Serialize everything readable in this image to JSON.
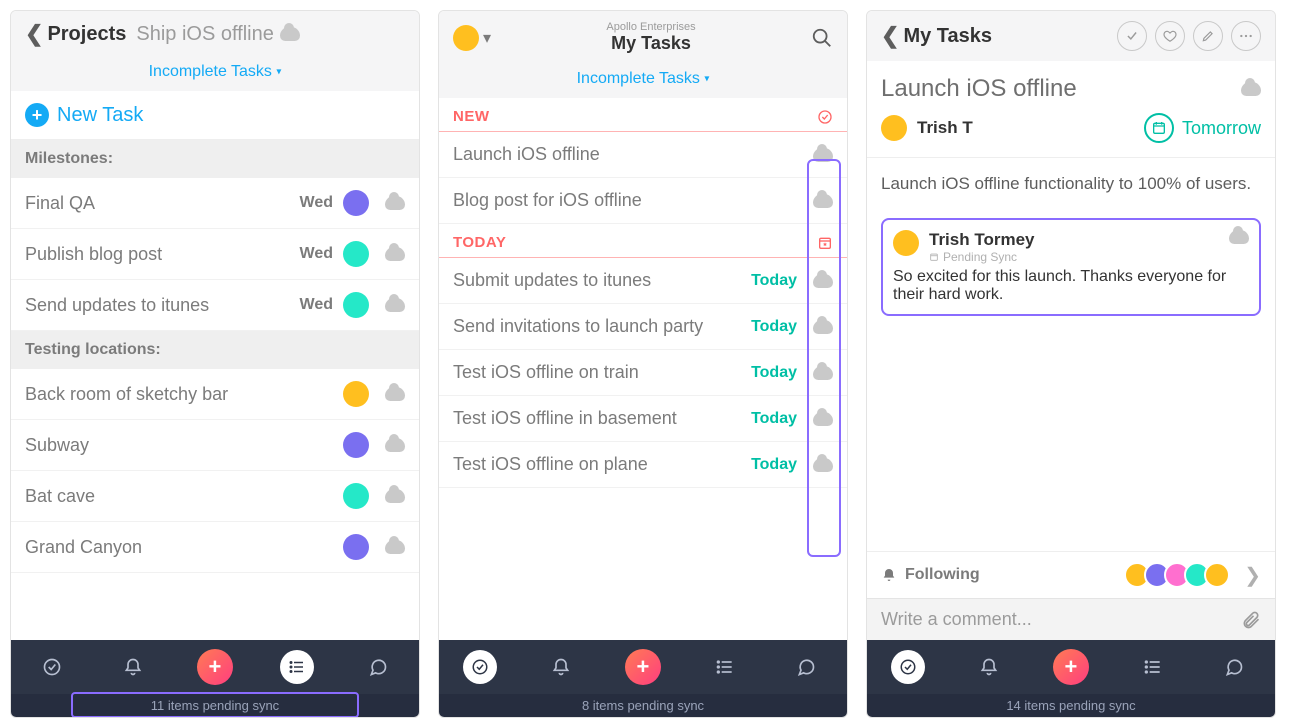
{
  "screen1": {
    "back_label": "Projects",
    "project_title": "Ship iOS offline",
    "filter": "Incomplete Tasks",
    "new_task": "New Task",
    "section_milestones": "Milestones:",
    "milestones": [
      {
        "name": "Final QA",
        "due": "Wed",
        "avatar": "purple"
      },
      {
        "name": "Publish blog post",
        "due": "Wed",
        "avatar": "green"
      },
      {
        "name": "Send updates to itunes",
        "due": "Wed",
        "avatar": "green"
      }
    ],
    "section_testing": "Testing locations:",
    "testing": [
      {
        "name": "Back room of sketchy bar",
        "avatar": "yellow"
      },
      {
        "name": "Subway",
        "avatar": "purple"
      },
      {
        "name": "Bat cave",
        "avatar": "green"
      },
      {
        "name": "Grand Canyon",
        "avatar": "purple"
      }
    ],
    "pending_sync": "11 items pending sync"
  },
  "screen2": {
    "org": "Apollo Enterprises",
    "title": "My Tasks",
    "filter": "Incomplete Tasks",
    "group_new": "NEW",
    "new_tasks": [
      {
        "name": "Launch iOS offline"
      },
      {
        "name": "Blog post for iOS offline"
      }
    ],
    "group_today": "TODAY",
    "today_tasks": [
      {
        "name": "Submit updates to itunes",
        "due": "Today"
      },
      {
        "name": "Send invitations to launch party",
        "due": "Today"
      },
      {
        "name": "Test iOS offline on train",
        "due": "Today"
      },
      {
        "name": "Test iOS offline in basement",
        "due": "Today"
      },
      {
        "name": "Test iOS offline on plane",
        "due": "Today"
      }
    ],
    "pending_sync": "8 items pending sync"
  },
  "screen3": {
    "back_label": "My Tasks",
    "task_title": "Launch iOS offline",
    "assignee": "Trish T",
    "due": "Tomorrow",
    "description": "Launch iOS offline functionality to 100% of users.",
    "comment": {
      "author": "Trish Tormey",
      "pending": "Pending Sync",
      "body": "So excited for this launch. Thanks everyone for their hard work."
    },
    "following": "Following",
    "follower_avatars": [
      "yellow",
      "purple",
      "pink",
      "green",
      "yellow"
    ],
    "comment_placeholder": "Write a comment...",
    "pending_sync": "14 items pending sync"
  }
}
